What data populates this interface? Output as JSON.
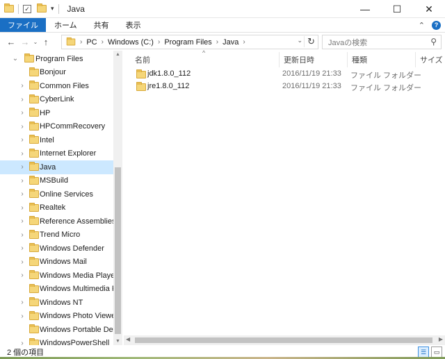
{
  "window": {
    "title": "Java",
    "controls": {
      "minimize": "—",
      "maximize": "☐",
      "close": "✕"
    }
  },
  "quick_access": {
    "dropdown_glyph": "▾",
    "check_glyph": "✓"
  },
  "ribbon": {
    "tabs": [
      "ファイル",
      "ホーム",
      "共有",
      "表示"
    ],
    "collapse_glyph": "⌃",
    "help_glyph": "?"
  },
  "nav": {
    "back": "←",
    "forward": "→",
    "recent": "⌄",
    "up": "↑",
    "breadcrumb": [
      "PC",
      "Windows (C:)",
      "Program Files",
      "Java"
    ],
    "breadcrumb_sep": "›",
    "dropdown_glyph": "⌄",
    "refresh_glyph": "↻"
  },
  "search": {
    "placeholder": "Javaの検索",
    "icon": "⚲"
  },
  "tree": {
    "root": {
      "label": "Program Files",
      "chevron": "⌄"
    },
    "items": [
      {
        "label": "Bonjour",
        "chevron": ""
      },
      {
        "label": "Common Files",
        "chevron": "›"
      },
      {
        "label": "CyberLink",
        "chevron": "›"
      },
      {
        "label": "HP",
        "chevron": "›"
      },
      {
        "label": "HPCommRecovery",
        "chevron": "›"
      },
      {
        "label": "Intel",
        "chevron": "›"
      },
      {
        "label": "Internet Explorer",
        "chevron": "›"
      },
      {
        "label": "Java",
        "chevron": "›",
        "selected": true
      },
      {
        "label": "MSBuild",
        "chevron": "›"
      },
      {
        "label": "Online Services",
        "chevron": "›"
      },
      {
        "label": "Realtek",
        "chevron": "›"
      },
      {
        "label": "Reference Assemblies",
        "chevron": "›"
      },
      {
        "label": "Trend Micro",
        "chevron": "›"
      },
      {
        "label": "Windows Defender",
        "chevron": "›"
      },
      {
        "label": "Windows Mail",
        "chevron": "›"
      },
      {
        "label": "Windows Media Player",
        "chevron": "›"
      },
      {
        "label": "Windows Multimedia Pla",
        "chevron": ""
      },
      {
        "label": "Windows NT",
        "chevron": "›"
      },
      {
        "label": "Windows Photo Viewer",
        "chevron": "›"
      },
      {
        "label": "Windows Portable Device",
        "chevron": ""
      },
      {
        "label": "WindowsPowerShell",
        "chevron": "›"
      }
    ]
  },
  "list": {
    "sort_glyph": "^",
    "columns": [
      "名前",
      "更新日時",
      "種類",
      "サイズ"
    ],
    "rows": [
      {
        "name": "jdk1.8.0_112",
        "modified": "2016/11/19 21:33",
        "type": "ファイル フォルダー"
      },
      {
        "name": "jre1.8.0_112",
        "modified": "2016/11/19 21:33",
        "type": "ファイル フォルダー"
      }
    ]
  },
  "scroll": {
    "up": "▲",
    "down": "▼",
    "left": "◀",
    "right": "▶"
  },
  "status": {
    "item_count": "2 個の項目"
  },
  "view_buttons": {
    "details": "☰",
    "tiles": "▭"
  }
}
